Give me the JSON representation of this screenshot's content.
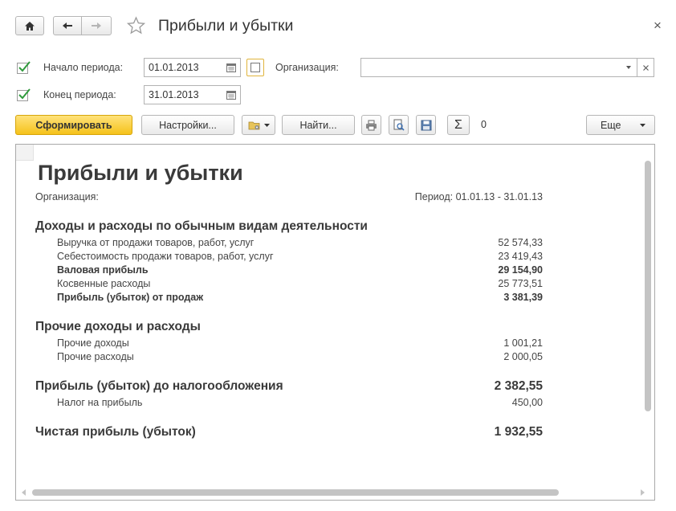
{
  "window": {
    "title": "Прибыли и убытки",
    "close_glyph": "×",
    "home_icon": "home-icon",
    "back_icon": "arrow-left-icon",
    "forward_icon": "arrow-right-icon",
    "favorite_icon": "star-icon"
  },
  "filters": {
    "start_label": "Начало периода:",
    "start_value": "01.01.2013",
    "start_checked": true,
    "end_label": "Конец периода:",
    "end_value": "31.01.2013",
    "end_checked": true,
    "org_label": "Организация:",
    "org_value": ""
  },
  "toolbar": {
    "generate_label": "Сформировать",
    "settings_label": "Настройки...",
    "find_label": "Найти...",
    "sum_value": "0",
    "more_label": "Еще"
  },
  "report": {
    "title": "Прибыли и убытки",
    "org_label": "Организация:",
    "period_text": "Период: 01.01.13 - 31.01.13",
    "sections": [
      {
        "title": "Доходы и расходы по обычным видам деятельности",
        "rows": [
          {
            "label": "Выручка от продажи товаров, работ, услуг",
            "value": "52 574,33",
            "bold": false
          },
          {
            "label": "Себестоимость продажи товаров, работ, услуг",
            "value": "23 419,43",
            "bold": false
          },
          {
            "label": "Валовая прибыль",
            "value": "29 154,90",
            "bold": true
          },
          {
            "label": "Косвенные расходы",
            "value": "25 773,51",
            "bold": false
          },
          {
            "label": "Прибыль (убыток) от продаж",
            "value": "3 381,39",
            "bold": true
          }
        ]
      },
      {
        "title": "Прочие доходы и расходы",
        "rows": [
          {
            "label": "Прочие доходы",
            "value": "1 001,21",
            "bold": false
          },
          {
            "label": "Прочие расходы",
            "value": "2 000,05",
            "bold": false
          }
        ]
      }
    ],
    "pretax": {
      "title": "Прибыль (убыток) до налогообложения",
      "value": "2 382,55",
      "tax_label": "Налог на прибыль",
      "tax_value": "450,00"
    },
    "net": {
      "title": "Чистая прибыль (убыток)",
      "value": "1 932,55"
    }
  }
}
